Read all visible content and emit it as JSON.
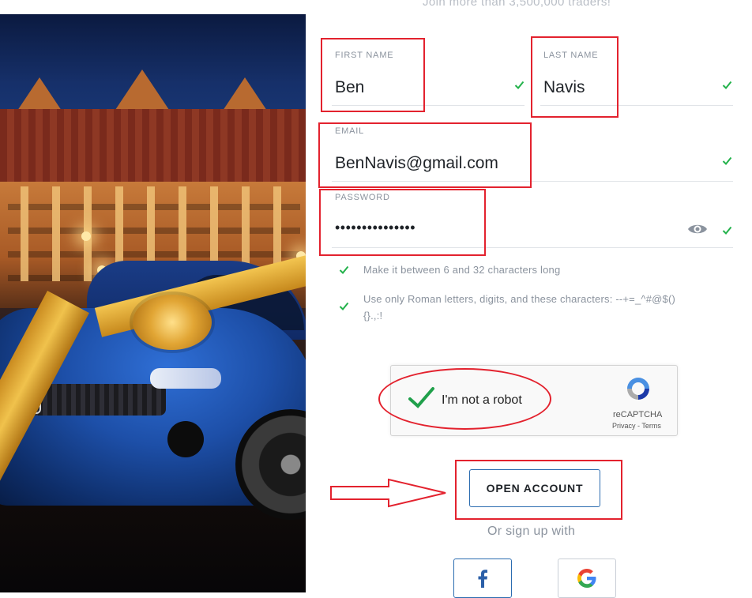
{
  "header": {
    "tagline": "Join more than 3,500,000 traders!"
  },
  "form": {
    "first_name": {
      "label": "FIRST NAME",
      "value": "Ben",
      "valid": true
    },
    "last_name": {
      "label": "LAST NAME",
      "value": "Navis",
      "valid": true
    },
    "email": {
      "label": "EMAIL",
      "value": "BenNavis@gmail.com",
      "valid": true
    },
    "password": {
      "label": "PASSWORD",
      "value": "•••••••••••••••",
      "valid": true,
      "toggle_icon": "eye-icon"
    },
    "rules": [
      {
        "text": "Make it between 6 and 32 characters long",
        "met": true
      },
      {
        "text": "Use only Roman letters, digits, and these characters: --+=_^#@$()",
        "text_cont": "{}.,:!",
        "met": true
      }
    ]
  },
  "recaptcha": {
    "label": "I'm not a robot",
    "brand": "reCAPTCHA",
    "links": "Privacy - Terms",
    "checked": true
  },
  "actions": {
    "open_account": "OPEN ACCOUNT",
    "or_sign_up": "Or sign up with"
  },
  "social": [
    {
      "name": "facebook",
      "icon": "facebook-icon"
    },
    {
      "name": "google",
      "icon": "google-icon"
    }
  ],
  "colors": {
    "accent": "#2b6cb0",
    "valid": "#23b24b",
    "highlight": "#e3222e",
    "muted": "#8b939e"
  }
}
